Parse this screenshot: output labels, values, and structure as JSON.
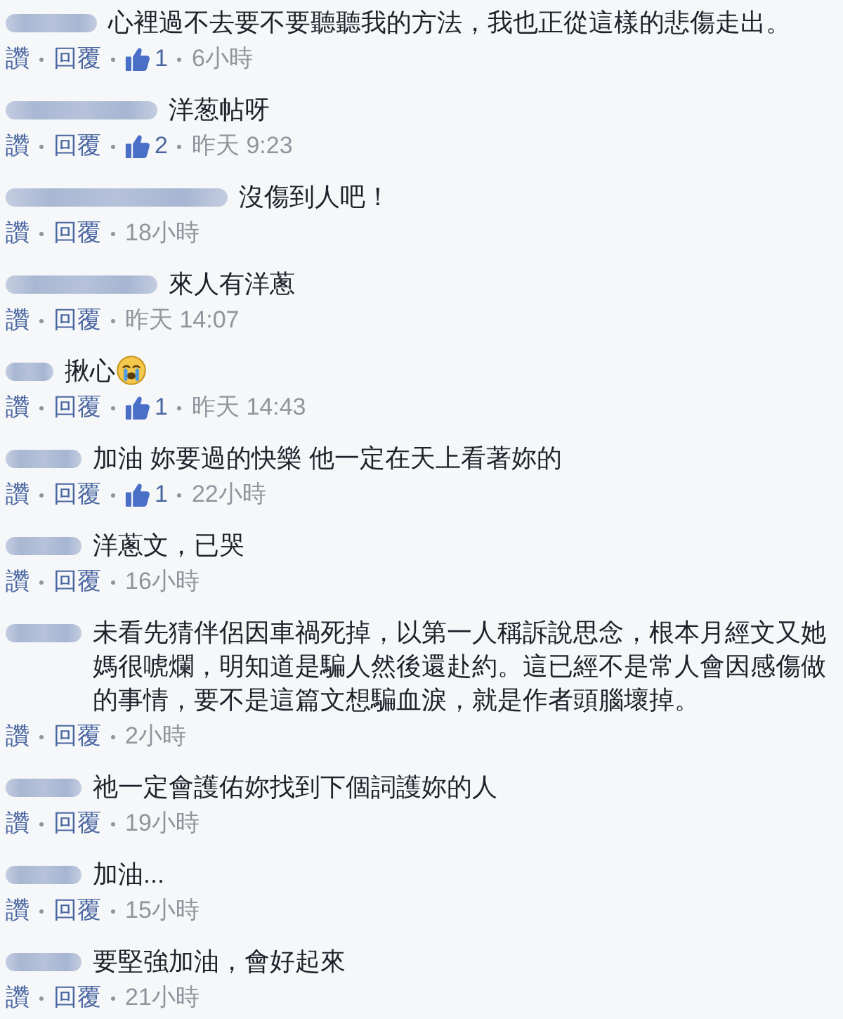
{
  "comments": [
    {
      "author": {
        "kind": "medium"
      },
      "text": "心裡過不去要不要聽聽我的方法，我也正從這樣的悲傷走出。",
      "actions": [
        "讚",
        "回覆"
      ],
      "likes": "1",
      "time": "6小時"
    },
    {
      "author": {
        "kind": "long"
      },
      "text": "洋葱帖呀",
      "actions": [
        "讚",
        "回覆"
      ],
      "likes": "2",
      "time": "昨天 9:23"
    },
    {
      "author": {
        "kind": "longer"
      },
      "text": "沒傷到人吧！",
      "actions": [
        "讚",
        "回覆"
      ],
      "time": "18小時"
    },
    {
      "author": {
        "kind": "long"
      },
      "text": "來人有洋蔥",
      "actions": [
        "讚",
        "回覆"
      ],
      "time": "昨天 14:07"
    },
    {
      "author": {
        "kind": "tiny"
      },
      "text": "揪心",
      "emoji": {
        "kind": "crying"
      },
      "actions": [
        "讚",
        "回覆"
      ],
      "likes": "1",
      "time": "昨天 14:43"
    },
    {
      "author": {
        "kind": "short"
      },
      "text": "加油 妳要過的快樂 他一定在天上看著妳的",
      "actions": [
        "讚",
        "回覆"
      ],
      "likes": "1",
      "time": "22小時"
    },
    {
      "author": {
        "kind": "short"
      },
      "text": "洋蔥文，已哭",
      "actions": [
        "讚",
        "回覆"
      ],
      "time": "16小時"
    },
    {
      "author": {
        "kind": "short"
      },
      "text": "未看先猜伴侶因車禍死掉，以第一人稱訴說思念，根本月經文又她媽很唬爛，明知道是騙人然後還赴約。這已經不是常人會因感傷做的事情，要不是這篇文想騙血淚，就是作者頭腦壞掉。",
      "actions": [
        "讚",
        "回覆"
      ],
      "time": "2小時"
    },
    {
      "author": {
        "kind": "short"
      },
      "text": "祂一定會護佑妳找到下個詞護妳的人",
      "actions": [
        "讚",
        "回覆"
      ],
      "time": "19小時"
    },
    {
      "author": {
        "kind": "short"
      },
      "text": "加油...",
      "actions": [
        "讚",
        "回覆"
      ],
      "time": "15小時"
    },
    {
      "author": {
        "kind": "short"
      },
      "text": "要堅強加油，會好起來",
      "actions": [
        "讚",
        "回覆"
      ],
      "time": "21小時"
    }
  ]
}
